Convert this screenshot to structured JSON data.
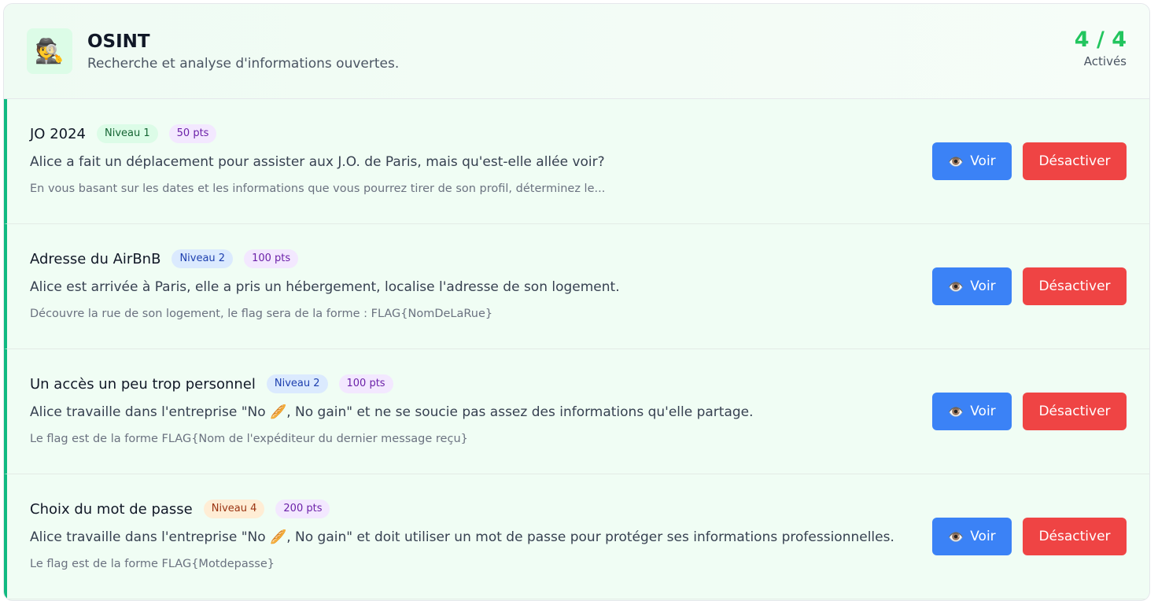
{
  "category": {
    "icon": "detective-icon",
    "icon_glyph": "🕵",
    "title": "OSINT",
    "description": "Recherche et analyse d'informations ouvertes.",
    "counter": "4 / 4",
    "counter_label": "Activés"
  },
  "challenges": [
    {
      "title": "JO 2024",
      "level": "Niveau 1",
      "points": "50 pts",
      "description": "Alice a fait un déplacement pour assister aux J.O. de Paris, mais qu'est-elle allée voir?",
      "hint": "En vous basant sur les dates et les informations que vous pourrez tirer de son profil, déterminez le...",
      "view_label": "Voir",
      "deactivate_label": "Désactiver"
    },
    {
      "title": "Adresse du AirBnB",
      "level": "Niveau 2",
      "points": "100 pts",
      "description": "Alice est arrivée à Paris, elle a pris un hébergement, localise l'adresse de son logement.",
      "hint": "Découvre la rue de son logement, le flag sera de la forme : FLAG{NomDeLaRue}",
      "view_label": "Voir",
      "deactivate_label": "Désactiver"
    },
    {
      "title": "Un accès un peu trop personnel",
      "level": "Niveau 2",
      "points": "100 pts",
      "description": "Alice travaille dans l'entreprise \"No 🥖, No gain\" et ne se soucie pas assez des informations qu'elle partage.",
      "hint": "Le flag est de la forme FLAG{Nom de l'expéditeur du dernier message reçu}",
      "view_label": "Voir",
      "deactivate_label": "Désactiver"
    },
    {
      "title": "Choix du mot de passe",
      "level": "Niveau 4",
      "points": "200 pts",
      "description": "Alice travaille dans l'entreprise \"No 🥖, No gain\" et doit utiliser un mot de passe pour protéger ses informations professionnelles.",
      "hint": "Le flag est de la forme FLAG{Motdepasse}",
      "view_label": "Voir",
      "deactivate_label": "Désactiver"
    }
  ],
  "view_icon": "eye-icon",
  "view_icon_glyph": "👁️",
  "colors": {
    "accent_green": "#22c55e",
    "view_button": "#3b82f6",
    "deactivate_button": "#ef4444"
  }
}
